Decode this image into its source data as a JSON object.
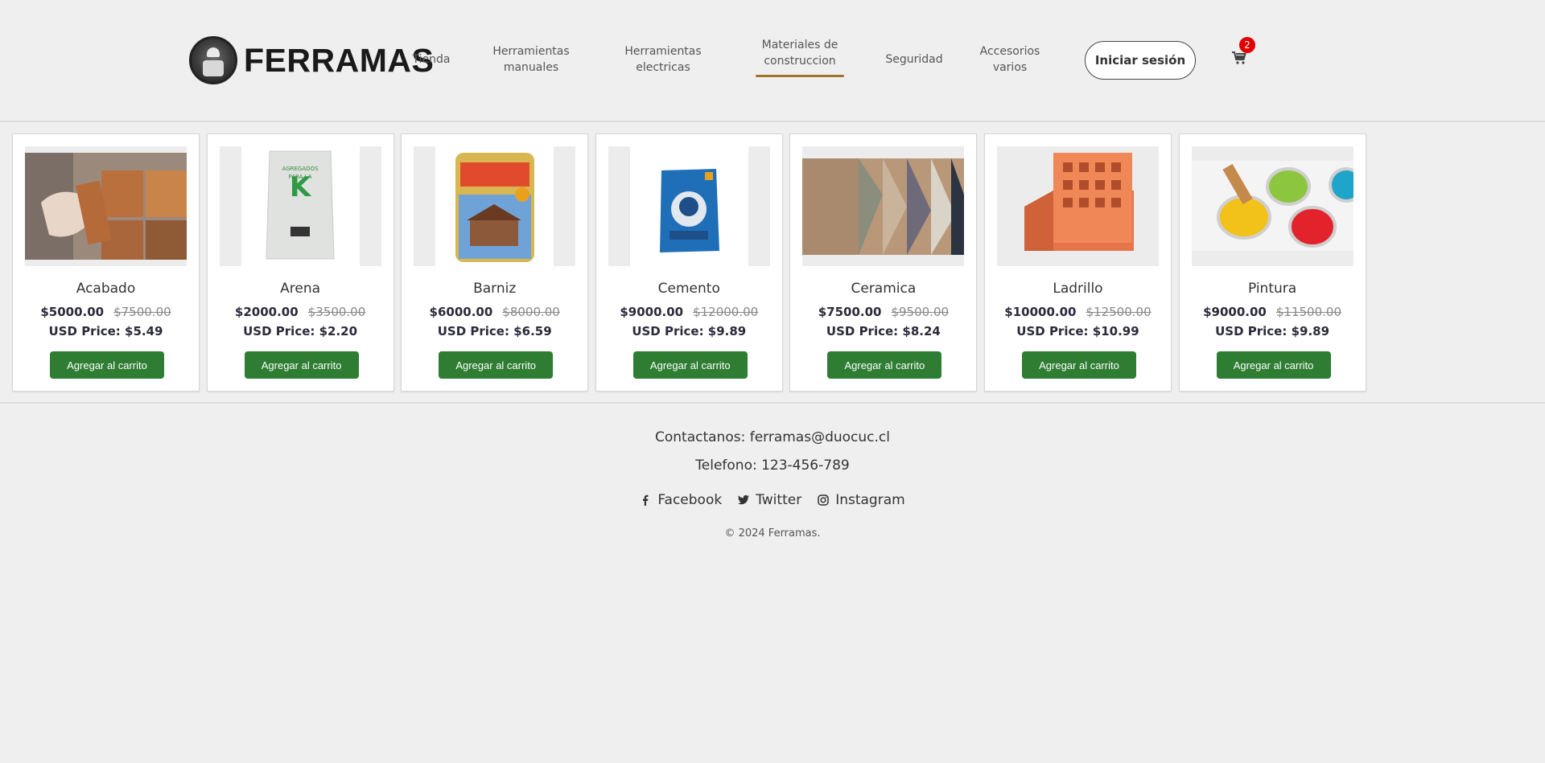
{
  "header": {
    "brand": "FERRAMAS",
    "nav": [
      {
        "label": "Tienda"
      },
      {
        "label": "Herramientas manuales"
      },
      {
        "label": "Herramientas electricas"
      },
      {
        "label": "Materiales de construccion",
        "active": true
      },
      {
        "label": "Seguridad"
      },
      {
        "label": "Accesorios varios"
      }
    ],
    "login_label": "Iniciar sesión",
    "cart_count": "2",
    "active_color": "#a0722a"
  },
  "products": [
    {
      "name": "Acabado",
      "price": "$5000.00",
      "old_price": "$7500.00",
      "usd": "USD Price: $5.49",
      "button": "Agregar al carrito",
      "image": "tile-installation"
    },
    {
      "name": "Arena",
      "price": "$2000.00",
      "old_price": "$3500.00",
      "usd": "USD Price: $2.20",
      "button": "Agregar al carrito",
      "image": "sand-bag"
    },
    {
      "name": "Barniz",
      "price": "$6000.00",
      "old_price": "$8000.00",
      "usd": "USD Price: $6.59",
      "button": "Agregar al carrito",
      "image": "varnish-can"
    },
    {
      "name": "Cemento",
      "price": "$9000.00",
      "old_price": "$12000.00",
      "usd": "USD Price: $9.89",
      "button": "Agregar al carrito",
      "image": "cement-bag"
    },
    {
      "name": "Ceramica",
      "price": "$7500.00",
      "old_price": "$9500.00",
      "usd": "USD Price: $8.24",
      "button": "Agregar al carrito",
      "image": "ceramic-tiles"
    },
    {
      "name": "Ladrillo",
      "price": "$10000.00",
      "old_price": "$12500.00",
      "usd": "USD Price: $10.99",
      "button": "Agregar al carrito",
      "image": "brick"
    },
    {
      "name": "Pintura",
      "price": "$9000.00",
      "old_price": "$11500.00",
      "usd": "USD Price: $9.89",
      "button": "Agregar al carrito",
      "image": "paint-cans"
    }
  ],
  "footer": {
    "contact": "Contactanos: ferramas@duocuc.cl",
    "phone": "Telefono: 123-456-789",
    "socials": [
      {
        "label": "Facebook",
        "icon": "facebook-icon"
      },
      {
        "label": "Twitter",
        "icon": "twitter-icon"
      },
      {
        "label": "Instagram",
        "icon": "instagram-icon"
      }
    ],
    "copyright": "© 2024 Ferramas."
  },
  "colors": {
    "button_green": "#2e7d32",
    "badge_red": "#e20000",
    "background": "#efefef"
  }
}
